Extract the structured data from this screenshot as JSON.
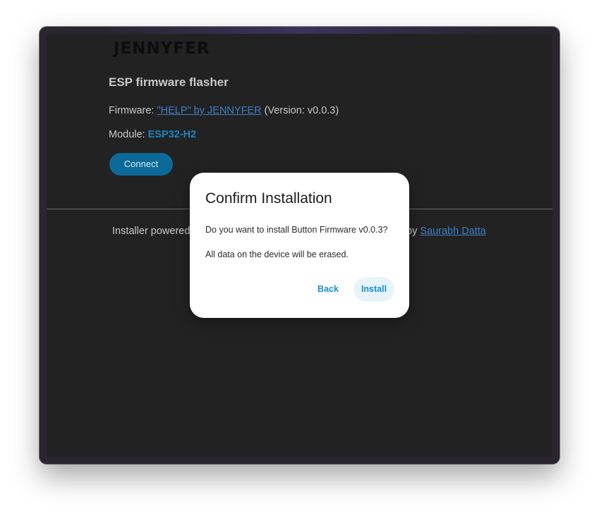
{
  "header": {
    "logo": "JENNYFER"
  },
  "main": {
    "title": "ESP firmware flasher",
    "firmware_label": "Firmware: ",
    "firmware_link": "\"HELP\" by JENNYFER",
    "firmware_version": " (Version: v0.0.3)",
    "module_label": "Module: ",
    "module_value": "ESP32-H2",
    "connect_label": "Connect"
  },
  "footer": {
    "left_text": "Installer powered",
    "right_prefix": "by ",
    "author_link": "Saurabh Datta"
  },
  "dialog": {
    "title": "Confirm Installation",
    "question": "Do you want to install Button Firmware v0.0.3?",
    "warning": "All data on the device will be erased.",
    "back_label": "Back",
    "install_label": "Install"
  },
  "colors": {
    "accent": "#1a8fd0",
    "connect_bg": "#0b6a98",
    "link": "#3d7fc7",
    "page_bg": "#222222"
  }
}
